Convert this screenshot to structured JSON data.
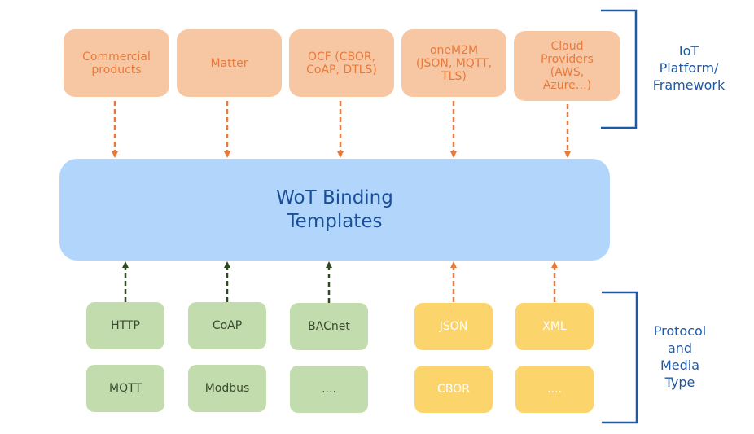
{
  "colors": {
    "platform_fill": "#f7c6a3",
    "platform_text": "#e87a3c",
    "core_fill": "#b2d6fb",
    "core_text": "#1a4f97",
    "protocol_fill": "#c2dcae",
    "protocol_text": "#3b4a2e",
    "media_fill": "#fcd46c",
    "media_text": "#ffffff",
    "orange_arrow": "#e87a3c",
    "green_arrow": "#2f4a22",
    "bracket": "#1f58a4"
  },
  "platforms": [
    {
      "label": "Commercial\nproducts"
    },
    {
      "label": "Matter"
    },
    {
      "label": "OCF (CBOR,\nCoAP, DTLS)"
    },
    {
      "label": "oneM2M\n(JSON, MQTT,\nTLS)"
    },
    {
      "label": "Cloud\nProviders\n(AWS,\nAzure…)"
    }
  ],
  "core": {
    "label": "WoT Binding\nTemplates"
  },
  "protocols": [
    {
      "label": "HTTP"
    },
    {
      "label": "CoAP"
    },
    {
      "label": "BACnet"
    },
    {
      "label": "MQTT"
    },
    {
      "label": "Modbus"
    },
    {
      "label": "...."
    }
  ],
  "media_types": [
    {
      "label": "JSON"
    },
    {
      "label": "XML"
    },
    {
      "label": "CBOR"
    },
    {
      "label": "...."
    }
  ],
  "groups": {
    "top": {
      "label": "IoT\nPlatform/\nFramework"
    },
    "bottom": {
      "label": "Protocol\nand\nMedia\nType"
    }
  },
  "arrows": {
    "platform_to_core": [
      {
        "from": "Commercial products",
        "to": "WoT Binding Templates",
        "style": "dashed",
        "color": "orange"
      },
      {
        "from": "Matter",
        "to": "WoT Binding Templates",
        "style": "dashed",
        "color": "orange"
      },
      {
        "from": "OCF",
        "to": "WoT Binding Templates",
        "style": "dashed",
        "color": "orange"
      },
      {
        "from": "oneM2M",
        "to": "WoT Binding Templates",
        "style": "dashed",
        "color": "orange"
      },
      {
        "from": "Cloud Providers",
        "to": "WoT Binding Templates",
        "style": "dashed",
        "color": "orange"
      }
    ],
    "bottom_to_core": [
      {
        "from": "HTTP",
        "to": "WoT Binding Templates",
        "style": "dashed",
        "color": "green"
      },
      {
        "from": "CoAP",
        "to": "WoT Binding Templates",
        "style": "dashed",
        "color": "green"
      },
      {
        "from": "BACnet",
        "to": "WoT Binding Templates",
        "style": "dashed",
        "color": "green"
      },
      {
        "from": "JSON",
        "to": "WoT Binding Templates",
        "style": "dashed",
        "color": "orange"
      },
      {
        "from": "XML",
        "to": "WoT Binding Templates",
        "style": "dashed",
        "color": "orange"
      }
    ]
  }
}
